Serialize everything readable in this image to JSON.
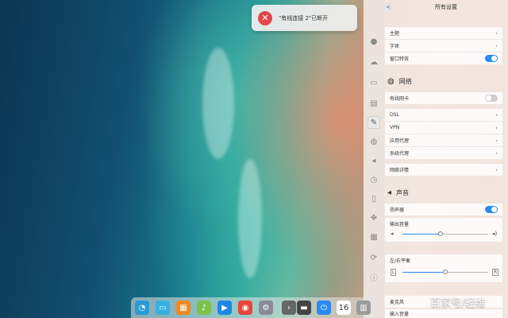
{
  "notification": {
    "text": "\"有线连接 2\"已断开",
    "icon": "network-disconnected-icon",
    "icon_color": "#e0474c"
  },
  "settings": {
    "title": "所有设置",
    "back_label": "<",
    "personalization": {
      "items": [
        {
          "label": "主题",
          "type": "link"
        },
        {
          "label": "字体",
          "type": "link"
        },
        {
          "label": "窗口特效",
          "type": "toggle",
          "on": true
        }
      ]
    },
    "network": {
      "title": "网络",
      "wired": {
        "label": "有线网卡",
        "on": false
      },
      "items": [
        "DSL",
        "VPN",
        "应用代理",
        "系统代理"
      ],
      "details": "网络详情"
    },
    "sound": {
      "title": "声音",
      "speaker": {
        "label": "扬声器",
        "on": true
      },
      "output_volume": {
        "label": "输出音量",
        "value": 0.44
      },
      "balance": {
        "label": "左/右平衡",
        "value": 0.5,
        "left": "L",
        "right": "R"
      },
      "mic": "麦克风",
      "input_volume": "输入音量"
    },
    "accent_color": "#2c8af0"
  },
  "dock": {
    "items": [
      {
        "name": "launcher-icon",
        "color": "#2a9ad6",
        "glyph": "◔"
      },
      {
        "name": "file-manager-icon",
        "color": "#36b0e0",
        "glyph": "▭"
      },
      {
        "name": "app-store-icon",
        "color": "#f08a24",
        "glyph": "▦"
      },
      {
        "name": "music-icon",
        "color": "#7cc24a",
        "glyph": "♪"
      },
      {
        "name": "video-icon",
        "color": "#1e88e5",
        "glyph": "▶"
      },
      {
        "name": "chrome-icon",
        "color": "#e8453c",
        "glyph": "◉"
      },
      {
        "name": "settings-icon",
        "color": "#8a8a9a",
        "glyph": "⚙"
      },
      {
        "name": "show-desktop-icon",
        "color": "#666666",
        "glyph": "›"
      },
      {
        "name": "keyboard-icon",
        "color": "#444444",
        "glyph": "▬"
      },
      {
        "name": "power-icon",
        "color": "#2c8af0",
        "glyph": "⏻"
      },
      {
        "name": "clock-icon",
        "color": "#ffffff",
        "glyph": "16"
      },
      {
        "name": "trash-icon",
        "color": "#9a9a9a",
        "glyph": "▥"
      }
    ]
  },
  "watermark": "百家号/轻维"
}
